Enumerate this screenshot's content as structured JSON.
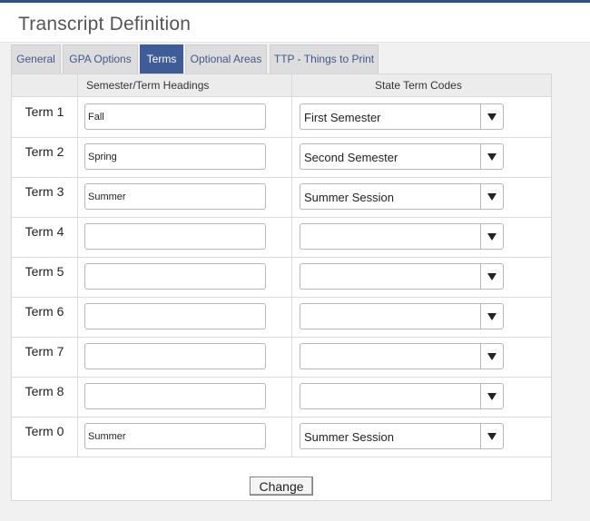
{
  "page": {
    "title": "Transcript Definition"
  },
  "tabs": [
    {
      "label": "General",
      "active": false
    },
    {
      "label": "GPA Options",
      "active": false
    },
    {
      "label": "Terms",
      "active": true
    },
    {
      "label": "Optional Areas",
      "active": false
    },
    {
      "label": "TTP - Things to Print",
      "active": false
    }
  ],
  "table": {
    "headers": {
      "headings": "Semester/Term Headings",
      "codes": "State Term Codes"
    },
    "rows": [
      {
        "label": "Term 1",
        "heading": "Fall",
        "code": "First Semester"
      },
      {
        "label": "Term 2",
        "heading": "Spring",
        "code": "Second Semester"
      },
      {
        "label": "Term 3",
        "heading": "Summer",
        "code": "Summer Session"
      },
      {
        "label": "Term 4",
        "heading": "",
        "code": ""
      },
      {
        "label": "Term 5",
        "heading": "",
        "code": ""
      },
      {
        "label": "Term 6",
        "heading": "",
        "code": ""
      },
      {
        "label": "Term 7",
        "heading": "",
        "code": ""
      },
      {
        "label": "Term 8",
        "heading": "",
        "code": ""
      },
      {
        "label": "Term 0",
        "heading": "Summer",
        "code": "Summer Session"
      }
    ]
  },
  "actions": {
    "change_label": "Change"
  },
  "colors": {
    "accent": "#2c4f8e",
    "active_tab": "#3e5d98",
    "tab_text": "#3f5a8a"
  }
}
